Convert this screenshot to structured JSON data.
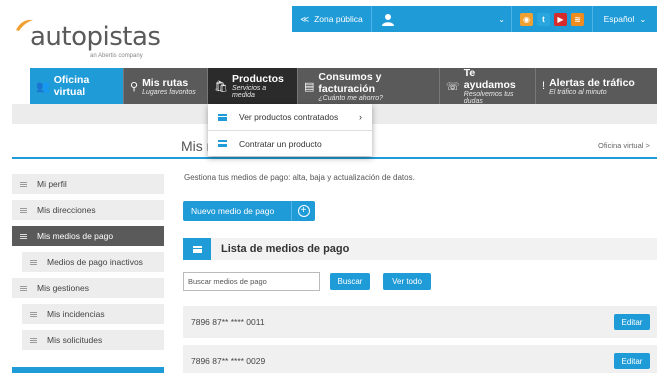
{
  "brand": {
    "name": "autopistas",
    "subtitle": "an Abertis company"
  },
  "topbar": {
    "zone_label": "Zona pública",
    "language": "Español",
    "social": [
      {
        "name": "rss-icon",
        "color": "#f0a030",
        "glyph": "◉"
      },
      {
        "name": "twitter-icon",
        "color": "#2aa6df",
        "glyph": "t"
      },
      {
        "name": "youtube-icon",
        "color": "#d52b2b",
        "glyph": "▶"
      },
      {
        "name": "feed-icon",
        "color": "#f08c1e",
        "glyph": "≋"
      }
    ]
  },
  "nav": {
    "home": "Oficina virtual",
    "items": [
      {
        "title": "Mis rutas",
        "subtitle": "Lugares favoritos"
      },
      {
        "title": "Productos",
        "subtitle": "Servicios a medida"
      },
      {
        "title": "Consumos y facturación",
        "subtitle": "¿Cuánto me ahorro?"
      },
      {
        "title": "Te ayudamos",
        "subtitle": "Resolvemos tus dudas"
      },
      {
        "title": "Alertas de tráfico",
        "subtitle": "El tráfico al minuto"
      }
    ]
  },
  "dropdown": {
    "items": [
      "Ver productos contratados",
      "Contratar un producto"
    ]
  },
  "page": {
    "title": "Mis medios de pago",
    "breadcrumb": "Oficina virtual >",
    "description": "Gestiona tus medios de pago: alta, baja y actualización de datos.",
    "new_button": "Nuevo medio de pago",
    "list_title": "Lista de medios de pago",
    "search_placeholder": "Buscar medios de pago",
    "search_button": "Buscar",
    "show_all_button": "Ver todo",
    "edit_label": "Editar",
    "rows": [
      "7896 87** **** 0011",
      "7896 87** **** 0029"
    ]
  },
  "sidebar": {
    "items": [
      {
        "label": "Mi perfil"
      },
      {
        "label": "Mis direcciones"
      },
      {
        "label": "Mis medios de pago"
      },
      {
        "label": "Medios de pago inactivos"
      },
      {
        "label": "Mis gestiones"
      },
      {
        "label": "Mis incidencias"
      },
      {
        "label": "Mis solicitudes"
      }
    ]
  },
  "colors": {
    "accent": "#1f9bd7",
    "nav_dark": "#5a5a5a",
    "logo_orange": "#f0a030"
  }
}
